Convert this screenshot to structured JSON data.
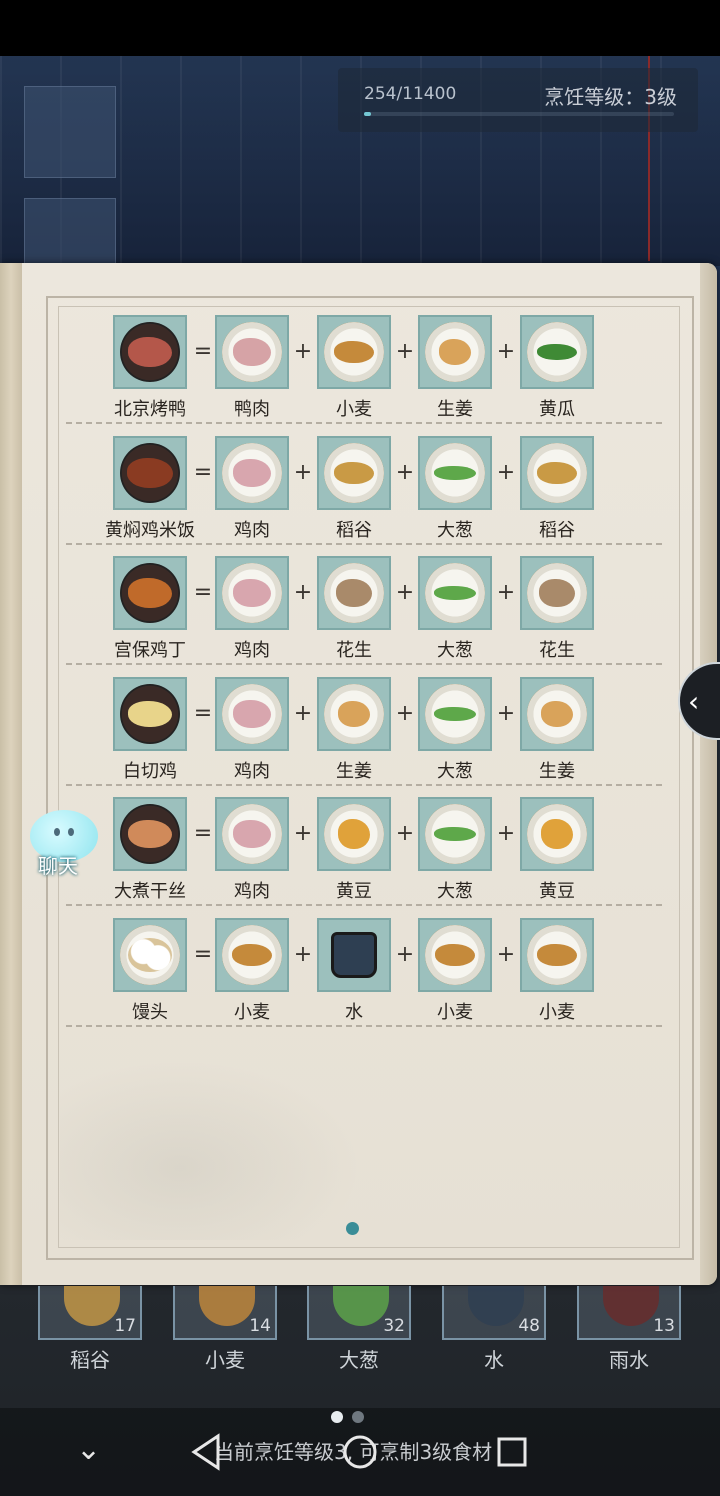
{
  "hud": {
    "exp_text": "254/11400",
    "exp_progress": 0.022,
    "level_text": "烹饪等级：3级"
  },
  "recipes": [
    {
      "dish": "北京烤鸭",
      "dish_icon": "roast-duck-icon",
      "ingredients": [
        {
          "label": "鸭肉",
          "icon": "duck-meat-icon"
        },
        {
          "label": "小麦",
          "icon": "wheat-icon"
        },
        {
          "label": "生姜",
          "icon": "ginger-icon"
        },
        {
          "label": "黄瓜",
          "icon": "cucumber-icon"
        }
      ]
    },
    {
      "dish": "黄焖鸡米饭",
      "dish_icon": "braised-chicken-rice-icon",
      "ingredients": [
        {
          "label": "鸡肉",
          "icon": "chicken-meat-icon"
        },
        {
          "label": "稻谷",
          "icon": "rice-grain-icon"
        },
        {
          "label": "大葱",
          "icon": "scallion-icon"
        },
        {
          "label": "稻谷",
          "icon": "rice-grain-icon"
        }
      ]
    },
    {
      "dish": "宫保鸡丁",
      "dish_icon": "kung-pao-chicken-icon",
      "ingredients": [
        {
          "label": "鸡肉",
          "icon": "chicken-meat-icon"
        },
        {
          "label": "花生",
          "icon": "peanut-icon"
        },
        {
          "label": "大葱",
          "icon": "scallion-icon"
        },
        {
          "label": "花生",
          "icon": "peanut-icon"
        }
      ]
    },
    {
      "dish": "白切鸡",
      "dish_icon": "white-cut-chicken-icon",
      "ingredients": [
        {
          "label": "鸡肉",
          "icon": "chicken-meat-icon"
        },
        {
          "label": "生姜",
          "icon": "ginger-icon"
        },
        {
          "label": "大葱",
          "icon": "scallion-icon"
        },
        {
          "label": "生姜",
          "icon": "ginger-icon"
        }
      ]
    },
    {
      "dish": "大煮干丝",
      "dish_icon": "boiled-tofu-shreds-icon",
      "ingredients": [
        {
          "label": "鸡肉",
          "icon": "chicken-meat-icon"
        },
        {
          "label": "黄豆",
          "icon": "soybean-icon"
        },
        {
          "label": "大葱",
          "icon": "scallion-icon"
        },
        {
          "label": "黄豆",
          "icon": "soybean-icon"
        }
      ]
    },
    {
      "dish": "馒头",
      "dish_icon": "steamed-bun-icon",
      "ingredients": [
        {
          "label": "小麦",
          "icon": "wheat-icon"
        },
        {
          "label": "水",
          "icon": "water-bucket-icon"
        },
        {
          "label": "小麦",
          "icon": "wheat-icon"
        },
        {
          "label": "小麦",
          "icon": "wheat-icon"
        }
      ]
    }
  ],
  "operators": {
    "equals": "=",
    "plus": "+"
  },
  "chat": {
    "label": "聊天"
  },
  "inventory": [
    {
      "label": "稻谷",
      "count": "17",
      "icon": "rice-grain-icon"
    },
    {
      "label": "小麦",
      "count": "14",
      "icon": "wheat-icon"
    },
    {
      "label": "大葱",
      "count": "32",
      "icon": "scallion-icon"
    },
    {
      "label": "水",
      "count": "48",
      "icon": "water-bucket-icon"
    },
    {
      "label": "雨水",
      "count": "13",
      "icon": "rain-water-bucket-icon"
    }
  ],
  "info_text": "当前烹饪等级3, 可烹制3级食材",
  "colors": {
    "cell_bg": "#9cc0bd",
    "page_dot": "#3a8d97",
    "book_paper": "#ece7dd"
  }
}
